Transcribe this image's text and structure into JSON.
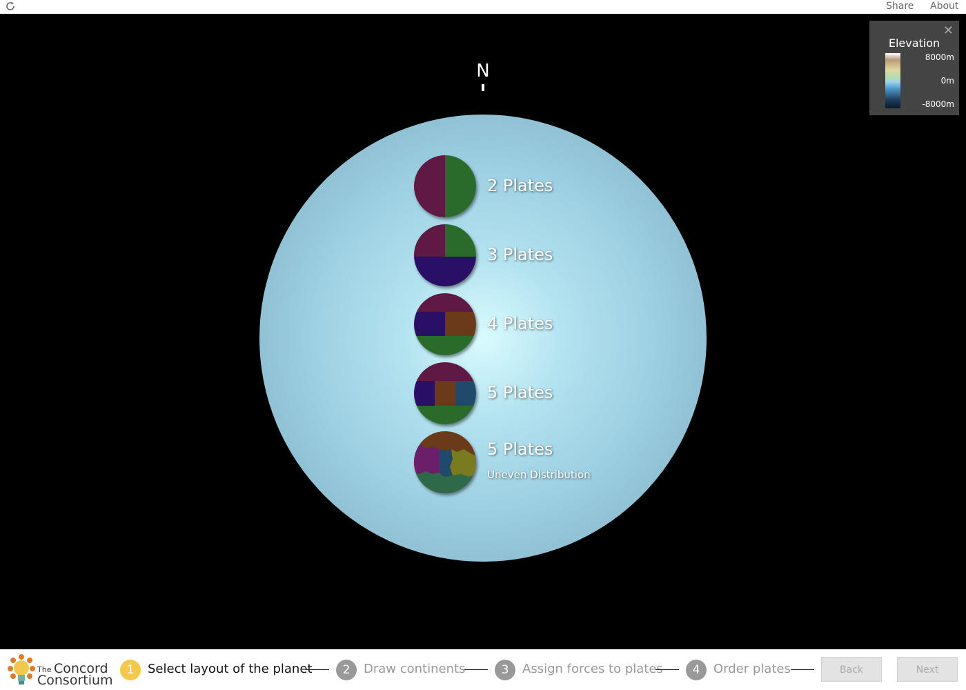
{
  "header": {
    "reload_icon": "reload-icon",
    "share_label": "Share",
    "about_label": "About"
  },
  "compass": {
    "north_label": "N"
  },
  "options": [
    {
      "label": "2 Plates",
      "sublabel": ""
    },
    {
      "label": "3 Plates",
      "sublabel": ""
    },
    {
      "label": "4 Plates",
      "sublabel": ""
    },
    {
      "label": "5 Plates",
      "sublabel": ""
    },
    {
      "label": "5 Plates",
      "sublabel": "Uneven Distribution"
    }
  ],
  "legend": {
    "title": "Elevation",
    "max_label": "8000m",
    "mid_label": "0m",
    "min_label": "-8000m",
    "close_icon": "close-icon"
  },
  "footer": {
    "logo": {
      "the": "The",
      "line1": "Concord",
      "line2": "Consortium"
    },
    "steps": [
      {
        "number": "1",
        "label": "Select layout of the planet",
        "active": true
      },
      {
        "number": "2",
        "label": "Draw continents",
        "active": false
      },
      {
        "number": "3",
        "label": "Assign forces to plates",
        "active": false
      },
      {
        "number": "4",
        "label": "Order plates",
        "active": false
      }
    ],
    "back_label": "Back",
    "next_label": "Next"
  },
  "colors": {
    "plate_purple": "#5e1a44",
    "plate_green": "#2a6a2a",
    "plate_indigo": "#2a0f66",
    "plate_brown": "#6b3a1a",
    "plate_teal": "#1f4a6b",
    "step_active": "#f2c94c",
    "step_inactive": "#999999"
  }
}
